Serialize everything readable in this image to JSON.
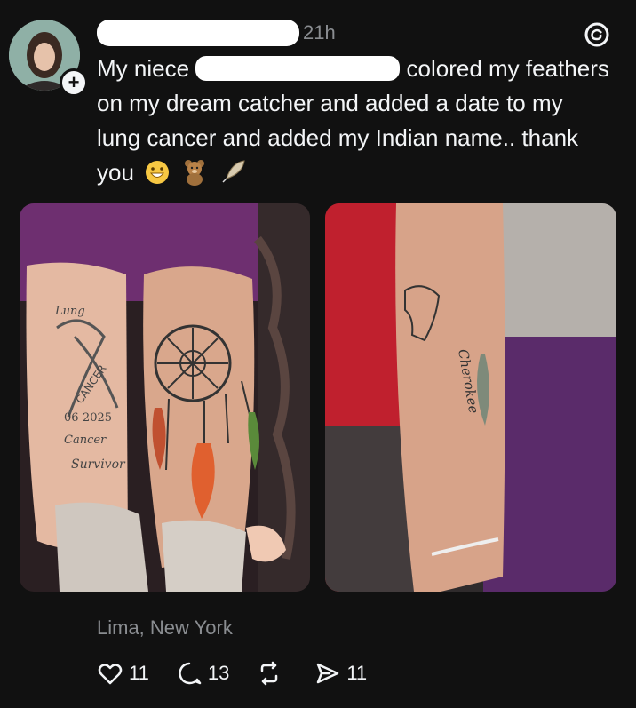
{
  "post": {
    "time": "21h",
    "line1_start": "My niece",
    "line1_end": "colored my",
    "body_rest": "feathers on my dream catcher and added a date to my lung cancer and added my Indian name.. thank you",
    "location": "Lima, New York"
  },
  "photo_left": {
    "lung_text": "Lung",
    "ribbon_text": "CANCER",
    "date_text": "06-2025",
    "cancer_text": "Cancer",
    "survivor_text": "Survivor"
  },
  "photo_right": {
    "name_text": "Cherokee"
  },
  "actions": {
    "likes": "11",
    "replies": "13",
    "shares": "11"
  },
  "colors": {
    "background": "#111111",
    "text": "#f3f5f7",
    "secondary": "#8a8d91"
  },
  "icons": [
    "plus-icon",
    "threads-logo-icon",
    "heart-icon",
    "reply-icon",
    "repost-icon",
    "share-icon"
  ]
}
